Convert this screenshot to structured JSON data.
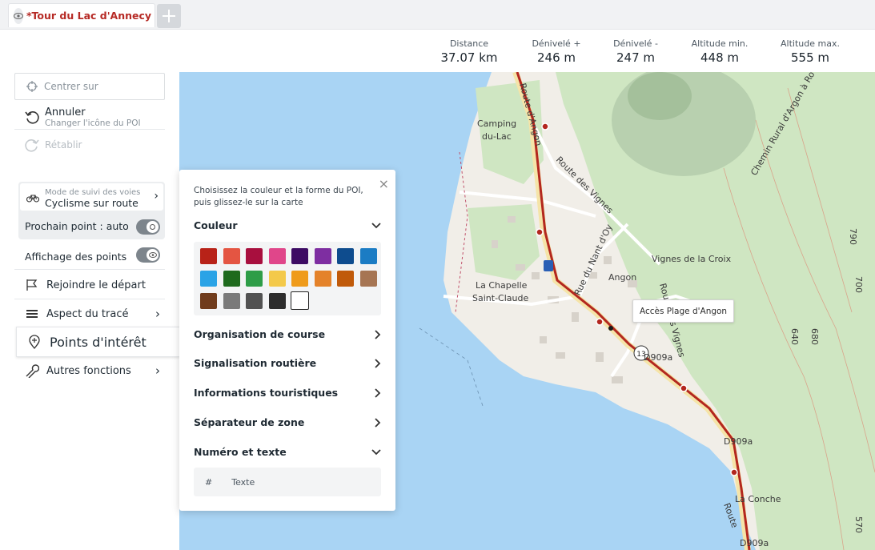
{
  "tab": {
    "title": "*Tour du Lac d'Annecy",
    "close": "×",
    "add": "+"
  },
  "stats": [
    {
      "label": "Distance",
      "value": "37.07 km"
    },
    {
      "label": "Dénivelé +",
      "value": "246 m"
    },
    {
      "label": "Dénivelé -",
      "value": "247 m"
    },
    {
      "label": "Altitude min.",
      "value": "448 m"
    },
    {
      "label": "Altitude max.",
      "value": "555 m"
    }
  ],
  "sidebar": {
    "center": "Centrer sur",
    "undo": {
      "label": "Annuler",
      "sub": "Changer l'icône du POI"
    },
    "redo": "Rétablir",
    "mode": {
      "sub": "Mode de suivi des voies",
      "value": "Cyclisme sur route"
    },
    "next_point": "Prochain point : auto",
    "show_points": "Affichage des points",
    "join_start": "Rejoindre le départ",
    "track_aspect": "Aspect du tracé",
    "poi": "Points d'intérêt",
    "other": "Autres fonctions"
  },
  "poi_panel": {
    "intro_1": "Choisissez la couleur et la forme du POI,",
    "intro_2": "puis glissez-le sur la carte",
    "color_title": "Couleur",
    "colors": [
      "#b82218",
      "#e45542",
      "#a80f3e",
      "#e0468a",
      "#3d0b63",
      "#7e2ea1",
      "#0e4c8e",
      "#1b7cc4",
      "#2aa3e6",
      "#1e6a1d",
      "#2e9d47",
      "#f3c94a",
      "#ef9b1b",
      "#e4822a",
      "#c05a0a",
      "#a67553",
      "#703c1c",
      "#7a7a7a",
      "#525252",
      "#2d2d2d",
      "#ffffff"
    ],
    "sections": [
      "Organisation de course",
      "Signalisation routière",
      "Informations touristiques",
      "Séparateur de zone"
    ],
    "number_title": "Numéro et texte",
    "hash": "#",
    "text_placeholder": "Texte"
  },
  "map": {
    "labels": {
      "camping_1": "Camping",
      "camping_2": "du-Lac",
      "chapelle_1": "La Chapelle",
      "chapelle_2": "Saint-Claude",
      "angon": "Angon",
      "vignes": "Vignes de la Croix",
      "conche": "La Conche",
      "route_vignes": "Route des Vignes",
      "rue_nant": "Rue du Nant d'Oy",
      "route_angon": "Route d'Angon",
      "chemin": "Chemin Rural d'Argon à Rovagny",
      "route_vignes_2": "Route des Vignes",
      "road_ref_1": "D909a",
      "road_ref_2": "D909a",
      "road_ref_3": "D909a",
      "route_top": "Route d'Angon",
      "route_bottom": "Route",
      "shield": "13",
      "c700": "700",
      "c640": "640",
      "c680": "680",
      "c570": "570",
      "c790": "790"
    },
    "tooltip": "Accès Plage d'Angon"
  }
}
